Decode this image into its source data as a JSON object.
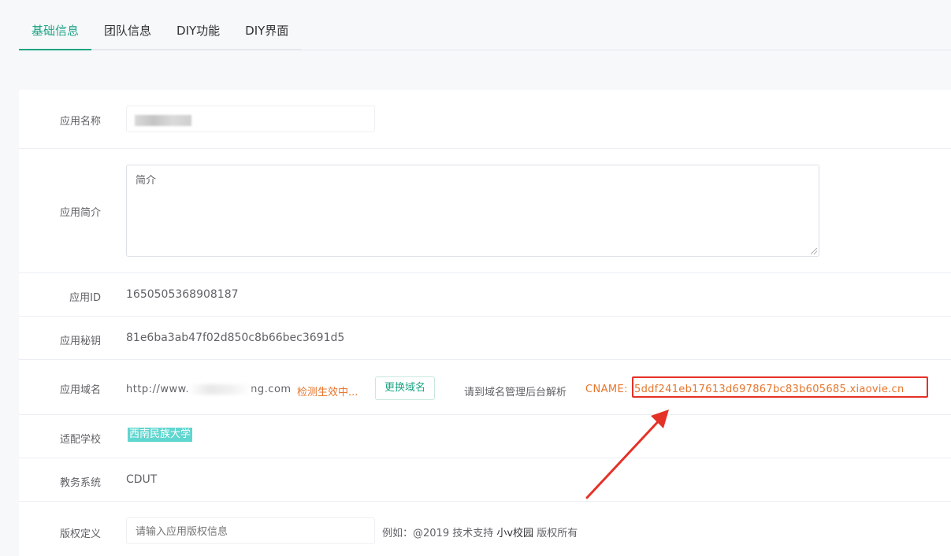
{
  "tabs": [
    {
      "label": "基础信息",
      "active": true
    },
    {
      "label": "团队信息",
      "active": false
    },
    {
      "label": "DIY功能",
      "active": false
    },
    {
      "label": "DIY界面",
      "active": false
    }
  ],
  "form": {
    "app_name": {
      "label": "应用名称"
    },
    "app_intro": {
      "label": "应用简介",
      "placeholder": "简介"
    },
    "app_id": {
      "label": "应用ID",
      "value": "1650505368908187"
    },
    "app_secret": {
      "label": "应用秘钥",
      "value": "81e6ba3ab47f02d850c8b66bec3691d5"
    },
    "app_domain": {
      "label": "应用域名",
      "value_prefix": "http://www.",
      "value_suffix": "ng.com",
      "status": "检测生效中...",
      "change_button": "更换域名",
      "hint": "请到域名管理后台解析",
      "cname_label": "CNAME:",
      "cname_value": "5ddf241eb17613d697867bc83b605685.xiaovie.cn"
    },
    "school": {
      "label": "适配学校",
      "value": "西南民族大学"
    },
    "edu_system": {
      "label": "教务系统",
      "value": "CDUT"
    },
    "copyright": {
      "label": "版权定义",
      "placeholder": "请输入应用版权信息",
      "example_prefix": "例如：@2019 技术支持",
      "example_brand": "小v校园",
      "example_suffix": "版权所有"
    }
  },
  "colors": {
    "accent": "#20a486",
    "warning": "#e6752c",
    "annotation": "#e53227",
    "school_tag": "#5fd6cf"
  }
}
